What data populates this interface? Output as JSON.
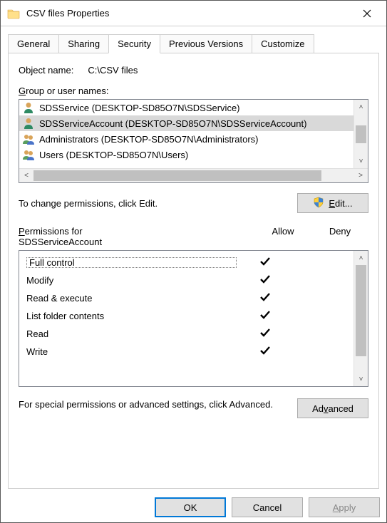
{
  "window": {
    "title": "CSV files Properties"
  },
  "tabs": {
    "general": "General",
    "sharing": "Sharing",
    "security": "Security",
    "previous": "Previous Versions",
    "customize": "Customize"
  },
  "object_name_label": "Object name:",
  "object_name_value": "C:\\CSV files",
  "group_label_prefix": "G",
  "group_label_rest": "roup or user names:",
  "groups": [
    {
      "text": "SDSService (DESKTOP-SD85O7N\\SDSService)",
      "selected": false,
      "icon": "user"
    },
    {
      "text": "SDSServiceAccount (DESKTOP-SD85O7N\\SDSServiceAccount)",
      "selected": true,
      "icon": "user"
    },
    {
      "text": "Administrators (DESKTOP-SD85O7N\\Administrators)",
      "selected": false,
      "icon": "group"
    },
    {
      "text": "Users (DESKTOP-SD85O7N\\Users)",
      "selected": false,
      "icon": "group"
    }
  ],
  "edit_hint": "To change permissions, click Edit.",
  "edit_btn_prefix": "E",
  "edit_btn_rest": "dit...",
  "perm_label_prefix": "P",
  "perm_label_rest": "ermissions for",
  "perm_principal": "SDSServiceAccount",
  "allow_label": "Allow",
  "deny_label": "Deny",
  "permissions": [
    {
      "name": "Full control",
      "allow": true,
      "deny": false
    },
    {
      "name": "Modify",
      "allow": true,
      "deny": false
    },
    {
      "name": "Read & execute",
      "allow": true,
      "deny": false
    },
    {
      "name": "List folder contents",
      "allow": true,
      "deny": false
    },
    {
      "name": "Read",
      "allow": true,
      "deny": false
    },
    {
      "name": "Write",
      "allow": true,
      "deny": false
    }
  ],
  "advanced_text": "For special permissions or advanced settings, click Advanced.",
  "advanced_btn_prefix": "v",
  "advanced_btn_before": "Ad",
  "advanced_btn_after": "anced",
  "buttons": {
    "ok": "OK",
    "cancel": "Cancel",
    "apply_prefix": "A",
    "apply_rest": "pply"
  }
}
